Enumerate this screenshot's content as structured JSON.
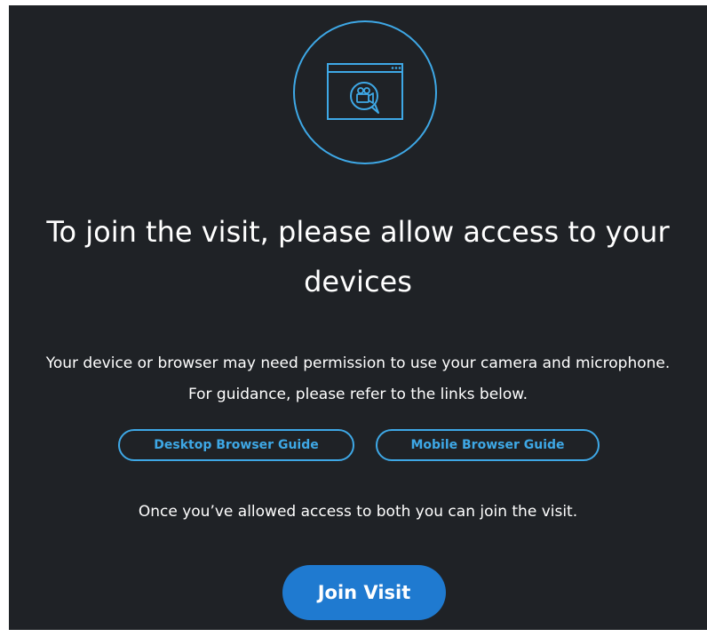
{
  "permission_dialog": {
    "icon": "video-chat-window-icon",
    "headline": "To join the visit, please allow access to your devices",
    "body_text": "Your device or browser may need permission to use your camera and microphone. For guidance, please refer to the links below.",
    "guide_links": [
      {
        "label": "Desktop Browser Guide"
      },
      {
        "label": "Mobile Browser Guide"
      }
    ],
    "allowed_text": "Once you’ve allowed access to both you can join the visit.",
    "join_label": "Join Visit"
  },
  "colors": {
    "background": "#1f2226",
    "accent": "#3ea8e6",
    "primary_button": "#1f7ad0",
    "text": "#ffffff"
  }
}
